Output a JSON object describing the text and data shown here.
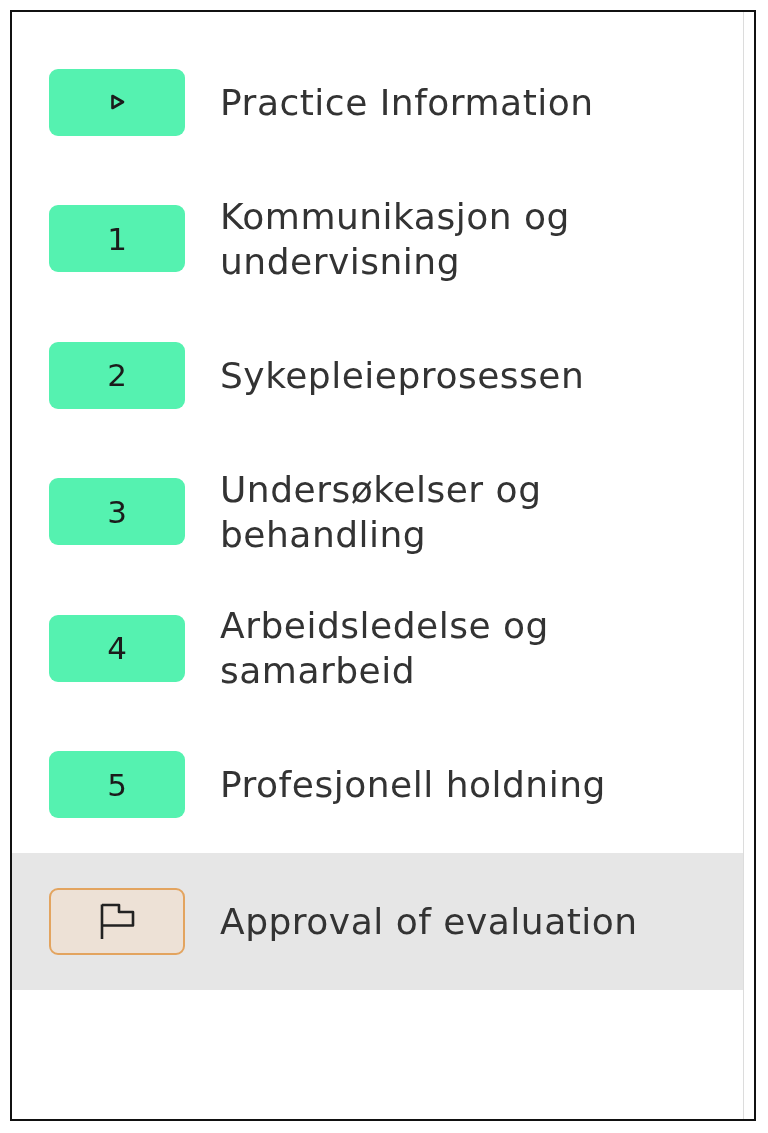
{
  "sidebar": {
    "items": [
      {
        "kind": "start",
        "label": "Practice Information",
        "selected": false
      },
      {
        "kind": "step",
        "number": "1",
        "label": "Kommunikasjon og undervisning",
        "selected": false
      },
      {
        "kind": "step",
        "number": "2",
        "label": "Sykepleieprosessen",
        "selected": false
      },
      {
        "kind": "step",
        "number": "3",
        "label": "Undersøkelser og behandling",
        "selected": false
      },
      {
        "kind": "step",
        "number": "4",
        "label": "Arbeidsledelse og samarbeid",
        "selected": false
      },
      {
        "kind": "step",
        "number": "5",
        "label": "Profesjonell holdning",
        "selected": false
      },
      {
        "kind": "approval",
        "label": "Approval of evaluation",
        "selected": true
      }
    ]
  }
}
